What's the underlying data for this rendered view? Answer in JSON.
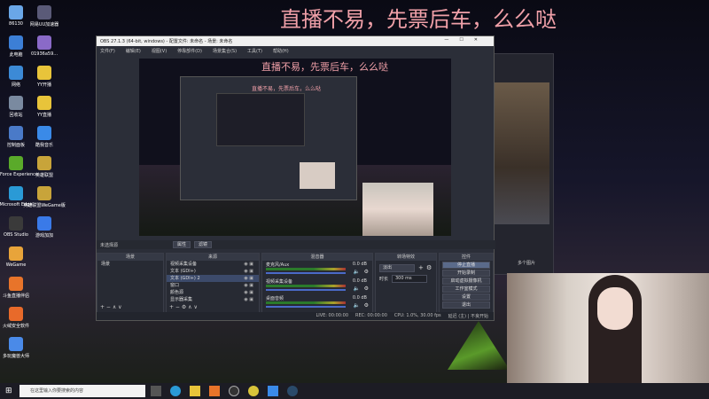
{
  "overlay": {
    "top_banner": "直播不易，先票后车，么么哒",
    "preview_banner": "直播不易，先票后车，么么哒",
    "nested_banner": "直播不易，先票后车，么么哒"
  },
  "desktop_icons": [
    {
      "label": "86130",
      "color": "#6aa7e8"
    },
    {
      "label": "网易UU加速器",
      "color": "#5a5a78"
    },
    {
      "label": "此电脑",
      "color": "#3c7fd6"
    },
    {
      "label": "01936a59...",
      "color": "#8a6ac8"
    },
    {
      "label": "网络",
      "color": "#3c8ad6"
    },
    {
      "label": "YY开播",
      "color": "#e8c43a"
    },
    {
      "label": "回收站",
      "color": "#7a8aa0"
    },
    {
      "label": "YY直播",
      "color": "#e8c43a"
    },
    {
      "label": "控制面板",
      "color": "#4a7ac8"
    },
    {
      "label": "酷我音乐",
      "color": "#3a8ae8"
    },
    {
      "label": "GeForce Experience",
      "color": "#5aaa2a"
    },
    {
      "label": "英雄联盟",
      "color": "#c8a43a"
    },
    {
      "label": "Microsoft Edge",
      "color": "#2a9ad6"
    },
    {
      "label": "英雄联盟WeGame版",
      "color": "#c8a43a"
    },
    {
      "label": "OBS Studio",
      "color": "#3a3a3a"
    },
    {
      "label": "游戏加加",
      "color": "#3a7ae8"
    },
    {
      "label": "WeGame",
      "color": "#e8a43a"
    },
    {
      "label": "斗鱼直播伴侣",
      "color": "#e8742a"
    },
    {
      "label": "火绒安全软件",
      "color": "#e86a2a"
    },
    {
      "label": "多玩魔兽大师",
      "color": "#4a8ae8"
    }
  ],
  "obs": {
    "title": "OBS 27.1.3 (64-bit, windows) - 配置文件: 未命名 - 场景: 未命名",
    "menu": [
      "文件(F)",
      "编辑(E)",
      "视图(V)",
      "停靠部件(D)",
      "场景集合(S)",
      "工具(T)",
      "帮助(H)"
    ],
    "source_toolbar_label": "未选择源",
    "source_toolbar_buttons": [
      "属性",
      "滤镜"
    ],
    "scenes_header": "场景",
    "scenes": [
      "场景"
    ],
    "sources_header": "来源",
    "sources": [
      "视频采集设备",
      "文本 (GDI+)",
      "文本 (GDI+) 2",
      "窗口",
      "颜色源",
      "显示器采集"
    ],
    "mixer_header": "混音器",
    "mixer": [
      {
        "name": "麦克风/Aux",
        "db": "0.0 dB"
      },
      {
        "name": "视频采集设备",
        "db": "0.0 dB"
      },
      {
        "name": "桌面音频",
        "db": "0.0 dB"
      }
    ],
    "transitions_header": "转场特效",
    "transition_type": "淡出",
    "duration_label": "时长",
    "duration_value": "300 ms",
    "controls_header": "控件",
    "controls": [
      "停止直播",
      "开始录制",
      "启动虚拟摄像机",
      "工作室模式",
      "设置",
      "退出"
    ],
    "status": {
      "live": "LIVE: 00:00:00",
      "rec": "REC: 00:00:00",
      "cpu": "CPU: 1.0%, 30.00 fps",
      "tail": "延迟 (主) | 不良开始"
    }
  },
  "side_panel": {
    "label": "多个图片"
  },
  "taskbar": {
    "search_placeholder": "在这里输入你要搜索的内容"
  }
}
